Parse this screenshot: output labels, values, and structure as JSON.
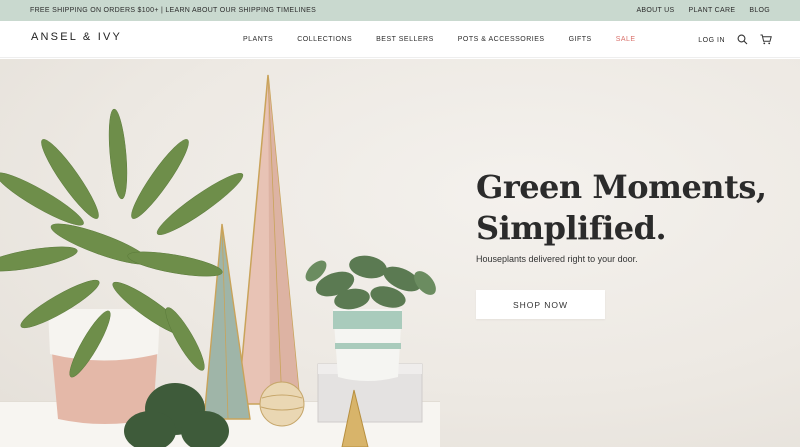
{
  "announcement": {
    "text": "FREE SHIPPING ON ORDERS $100+ | LEARN ABOUT OUR SHIPPING TIMELINES",
    "links": [
      "ABOUT US",
      "PLANT CARE",
      "BLOG"
    ]
  },
  "header": {
    "logo": "ANSEL & IVY",
    "menu": [
      "PLANTS",
      "COLLECTIONS",
      "BEST SELLERS",
      "POTS & ACCESSORIES",
      "GIFTS",
      "SALE"
    ],
    "login": "LOG IN"
  },
  "hero": {
    "headline_line1": "Green Moments,",
    "headline_line2": "Simplified.",
    "subtitle": "Houseplants delivered right to your door.",
    "cta": "SHOP NOW"
  },
  "colors": {
    "announcement_bg": "#c9d9cf",
    "sale": "#d9706a",
    "hero_bg": "#efebe6"
  },
  "icons": [
    "search-icon",
    "cart-icon"
  ]
}
